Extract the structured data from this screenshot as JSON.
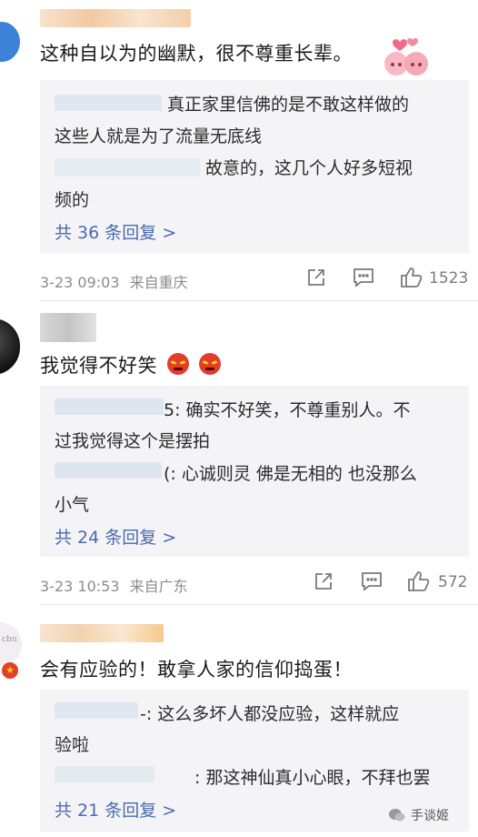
{
  "comments": [
    {
      "text": "这种自以为的幽默，很不尊重长辈。",
      "replies": [
        {
          "line1": "真正家里信佛的是不敢这样做的",
          "line2": "这些人就是为了流量无底线"
        },
        {
          "line1": "故意的，这几个人好多短视",
          "line2": "频的"
        }
      ],
      "more": "共 36 条回复 >",
      "time": "3-23 09:03",
      "source": "来自重庆",
      "likes": "1523"
    },
    {
      "text": "我觉得不好笑",
      "replies": [
        {
          "line1": "5: 确实不好笑，不尊重别人。不",
          "line2": "过我觉得这个是摆拍"
        },
        {
          "line1": "(: 心诚则灵 佛是无相的 也没那么",
          "line2": "小气"
        }
      ],
      "more": "共 24 条回复 >",
      "time": "3-23 10:53",
      "source": "来自广东",
      "likes": "572"
    },
    {
      "text": "会有应验的！敢拿人家的信仰捣蛋！",
      "replies": [
        {
          "line1": "-: 这么多坏人都没应验，这样就应",
          "line2": "验啦"
        },
        {
          "line1": ": 那这神仙真小心眼，不拜也罢",
          "line2": ""
        }
      ],
      "more": "共 21 条回复 >"
    }
  ],
  "watermark": "手谈姬",
  "avatar_text": "chu"
}
